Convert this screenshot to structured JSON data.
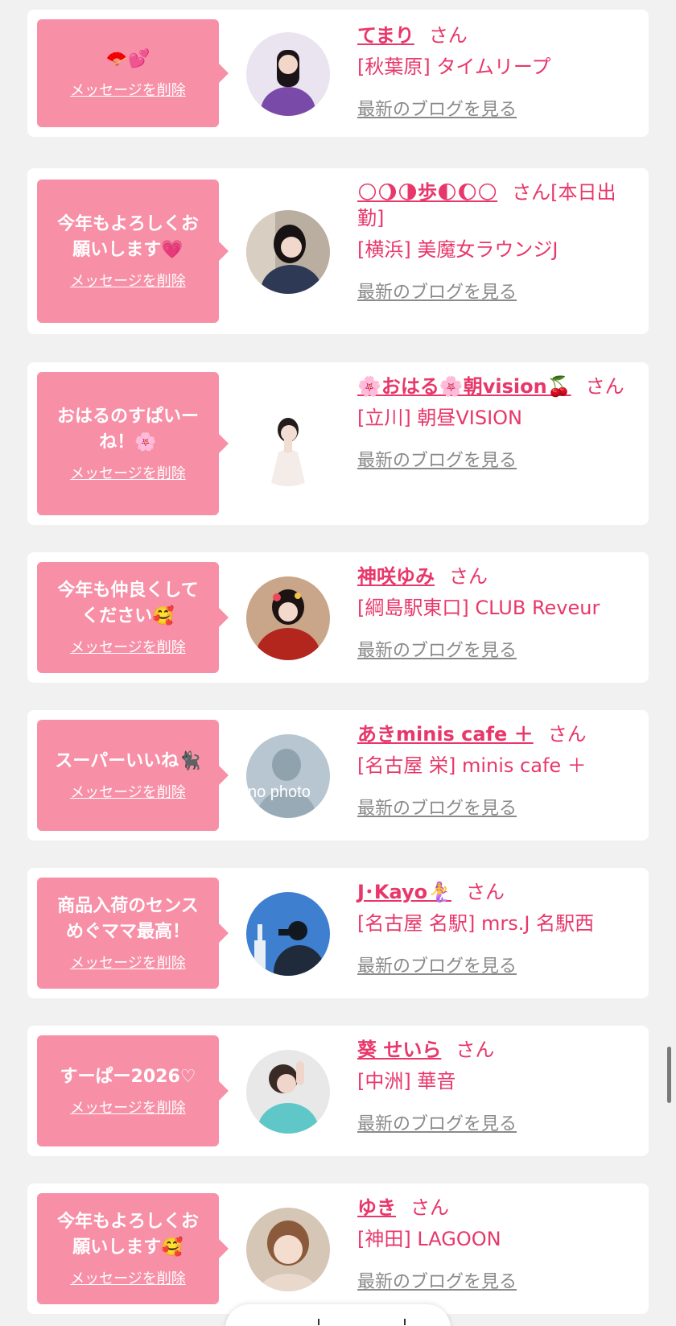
{
  "delete_label": "メッセージを削除",
  "blog_label": "最新のブログを見る",
  "honorific": "さん",
  "cards": [
    {
      "message": "🪭💕",
      "name": "てまり",
      "suffix": "",
      "shop": "[秋葉原] タイムリープ",
      "avatar": {
        "bg": "#e9e4f0",
        "figure": "#7a4aa8",
        "hair": "#1a1418",
        "skin": "#f2d6c8"
      }
    },
    {
      "message": "今年もよろしくお\n願いします💗",
      "name": "🌕🌖🌗歩🌓🌔🌕",
      "suffix": "[本日出勤]",
      "shop": "[横浜] 美魔女ラウンジJ",
      "avatar": {
        "bg": "#b9aea0",
        "figure": "#2e3a55",
        "hair": "#181214",
        "skin": "#f0d8cc"
      }
    },
    {
      "message": "おはるのすぱいー\nね！🌸",
      "name": "🌸おはる🌸朝vision🍒",
      "suffix": "",
      "shop": "[立川] 朝昼VISION",
      "avatar": {
        "bg": "#ffffff",
        "figure": "#f3ece8",
        "hair": "#241c1c",
        "skin": "#f1ddd2"
      }
    },
    {
      "message": "今年も仲良くして\nください🥰",
      "name": "神咲ゆみ",
      "suffix": "",
      "shop": "[綱島駅東口] CLUB Reveur",
      "avatar": {
        "bg": "#c9a58a",
        "figure": "#b3261e",
        "hair": "#1c1312",
        "skin": "#f3d9cc"
      }
    },
    {
      "message": "スーパーいいね🐈‍⬛",
      "name": "あきminis cafe ＋",
      "suffix": "",
      "shop": "[名古屋 栄] minis cafe ＋",
      "avatar": {
        "bg": "#b7c6d0",
        "figure": "#98aab6",
        "hair": "#8fa2ad",
        "skin": "#c7d4dc",
        "overlay": "no photo"
      }
    },
    {
      "message": "商品入荷のセンス\nめぐママ最高！",
      "name": "J･Kayo🧜‍♀️",
      "suffix": "",
      "shop": "[名古屋 名駅] mrs.J 名駅西",
      "avatar": {
        "bg": "#3f7fd0",
        "figure": "#1f2a3a",
        "hair": "#121820",
        "skin": "#7aa7e0"
      }
    },
    {
      "message": "すーぱー2026♡",
      "name": "葵 せいら",
      "suffix": "",
      "shop": "[中洲] 華音",
      "avatar": {
        "bg": "#e8e8e8",
        "figure": "#5fc7c7",
        "hair": "#3a2a26",
        "skin": "#f0d6ca"
      }
    },
    {
      "message": "今年もよろしくお\n願いします🥰",
      "name": "ゆき",
      "suffix": "",
      "shop": "[神田] LAGOON",
      "avatar": {
        "bg": "#d6c6b6",
        "figure": "#e9d9cc",
        "hair": "#8a5a3a",
        "skin": "#f4dccf"
      }
    }
  ]
}
